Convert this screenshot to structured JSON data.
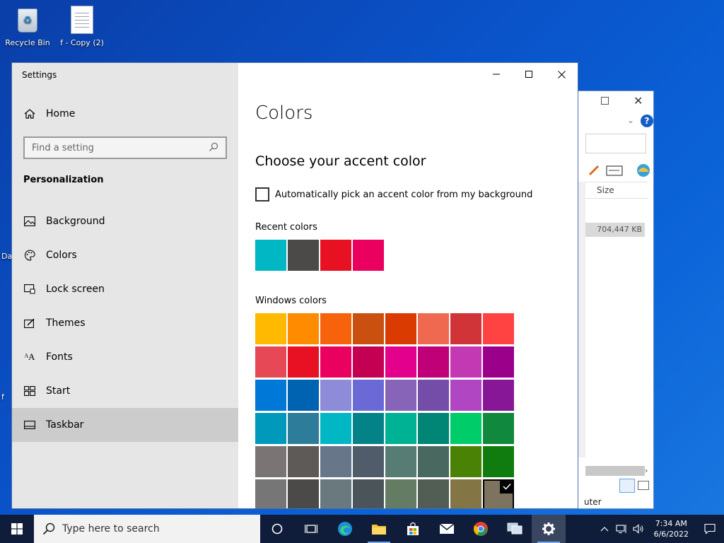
{
  "desktop": {
    "icons": [
      {
        "label": "Recycle Bin"
      },
      {
        "label": "f - Copy (2)"
      }
    ],
    "edge_labels": [
      "Da",
      "f"
    ]
  },
  "explorer": {
    "column_size": "Size",
    "file_size": "704,447 KB",
    "status_fragment": "uter",
    "help_label": "?"
  },
  "settings": {
    "window_title": "Settings",
    "home_label": "Home",
    "search_placeholder": "Find a setting",
    "section_heading": "Personalization",
    "nav_items": [
      {
        "label": "Background",
        "icon": "picture-icon"
      },
      {
        "label": "Colors",
        "icon": "palette-icon"
      },
      {
        "label": "Lock screen",
        "icon": "lock-screen-icon"
      },
      {
        "label": "Themes",
        "icon": "themes-icon"
      },
      {
        "label": "Fonts",
        "icon": "fonts-icon"
      },
      {
        "label": "Start",
        "icon": "start-icon"
      },
      {
        "label": "Taskbar",
        "icon": "taskbar-icon",
        "selected": true
      }
    ],
    "page_title": "Colors",
    "accent_heading": "Choose your accent color",
    "auto_pick_label": "Automatically pick an accent color from my background",
    "auto_pick_checked": false,
    "recent_label": "Recent colors",
    "recent_colors": [
      "#00b7c3",
      "#4c4a48",
      "#e81123",
      "#ea005e"
    ],
    "windows_label": "Windows colors",
    "windows_colors": [
      "#ffb900",
      "#ff8c00",
      "#f7630c",
      "#ca5010",
      "#da3b01",
      "#ef6950",
      "#d13438",
      "#ff4343",
      "#e74856",
      "#e81123",
      "#ea005e",
      "#c30052",
      "#e3008c",
      "#bf0077",
      "#c239b3",
      "#9a0089",
      "#0078d7",
      "#0063b1",
      "#8e8cd8",
      "#6b69d6",
      "#8764b8",
      "#744da9",
      "#b146c2",
      "#881798",
      "#0099bc",
      "#2d7d9a",
      "#00b7c3",
      "#038387",
      "#00b294",
      "#018574",
      "#00cc6a",
      "#10893e",
      "#7a7574",
      "#5d5a58",
      "#68768a",
      "#515c6b",
      "#567c73",
      "#486860",
      "#498205",
      "#107c10",
      "#767676",
      "#4c4a48",
      "#69797e",
      "#4a5459",
      "#647c64",
      "#525e54",
      "#847545",
      "#7e735f"
    ],
    "selected_color": "#7e735f"
  },
  "taskbar": {
    "search_placeholder": "Type here to search",
    "time": "7:34 AM",
    "date": "6/6/2022"
  }
}
